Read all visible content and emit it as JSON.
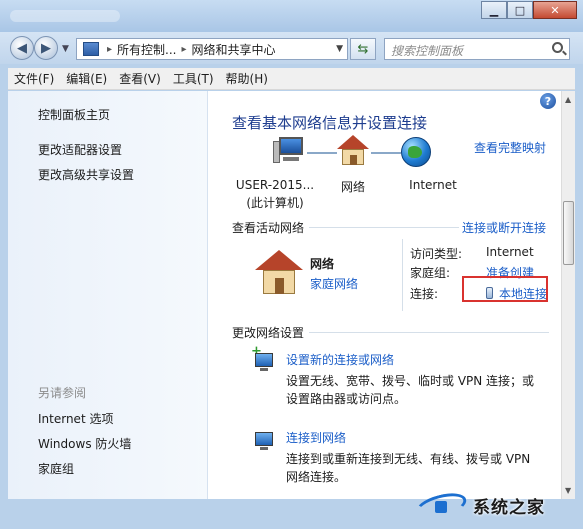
{
  "window": {
    "minimize_glyph": "▁",
    "maximize_glyph": "□",
    "close_glyph": "✕"
  },
  "address": {
    "seg_root": "所有控制...",
    "seg_current": "网络和共享中心",
    "separator": "▸",
    "search_placeholder": "搜索控制面板"
  },
  "menu": [
    "文件(F)",
    "编辑(E)",
    "查看(V)",
    "工具(T)",
    "帮助(H)"
  ],
  "sidebar": {
    "home": "控制面板主页",
    "links": [
      "更改适配器设置",
      "更改高级共享设置"
    ],
    "see_also_heading": "另请参阅",
    "see_also": [
      "Internet 选项",
      "Windows 防火墙",
      "家庭组"
    ]
  },
  "main": {
    "title": "查看基本网络信息并设置连接",
    "full_map": "查看完整映射",
    "map_nodes": {
      "computer_line1": "USER-2015...",
      "computer_line2": "(此计算机)",
      "network": "网络",
      "internet": "Internet"
    },
    "active_section": "查看活动网络",
    "connect_disconnect": "连接或断开连接",
    "active_network": {
      "name": "网络",
      "type": "家庭网络",
      "access_type_label": "访问类型:",
      "access_type_value": "Internet",
      "homegroup_label": "家庭组:",
      "homegroup_value": "准备创建",
      "connection_label": "连接:",
      "connection_value": "本地连接"
    },
    "change_section": "更改网络设置",
    "tasks": [
      {
        "title": "设置新的连接或网络",
        "desc_line1": "设置无线、宽带、拨号、临时或 VPN 连接；或",
        "desc_line2": "设置路由器或访问点。"
      },
      {
        "title": "连接到网络",
        "desc_line1": "连接到或重新连接到无线、有线、拨号或 VPN",
        "desc_line2": "网络连接。"
      }
    ]
  },
  "watermark": {
    "text": "系统之家"
  },
  "colors": {
    "link": "#1b5ec8",
    "title": "#1e3d8f",
    "highlight": "#d9322f"
  }
}
